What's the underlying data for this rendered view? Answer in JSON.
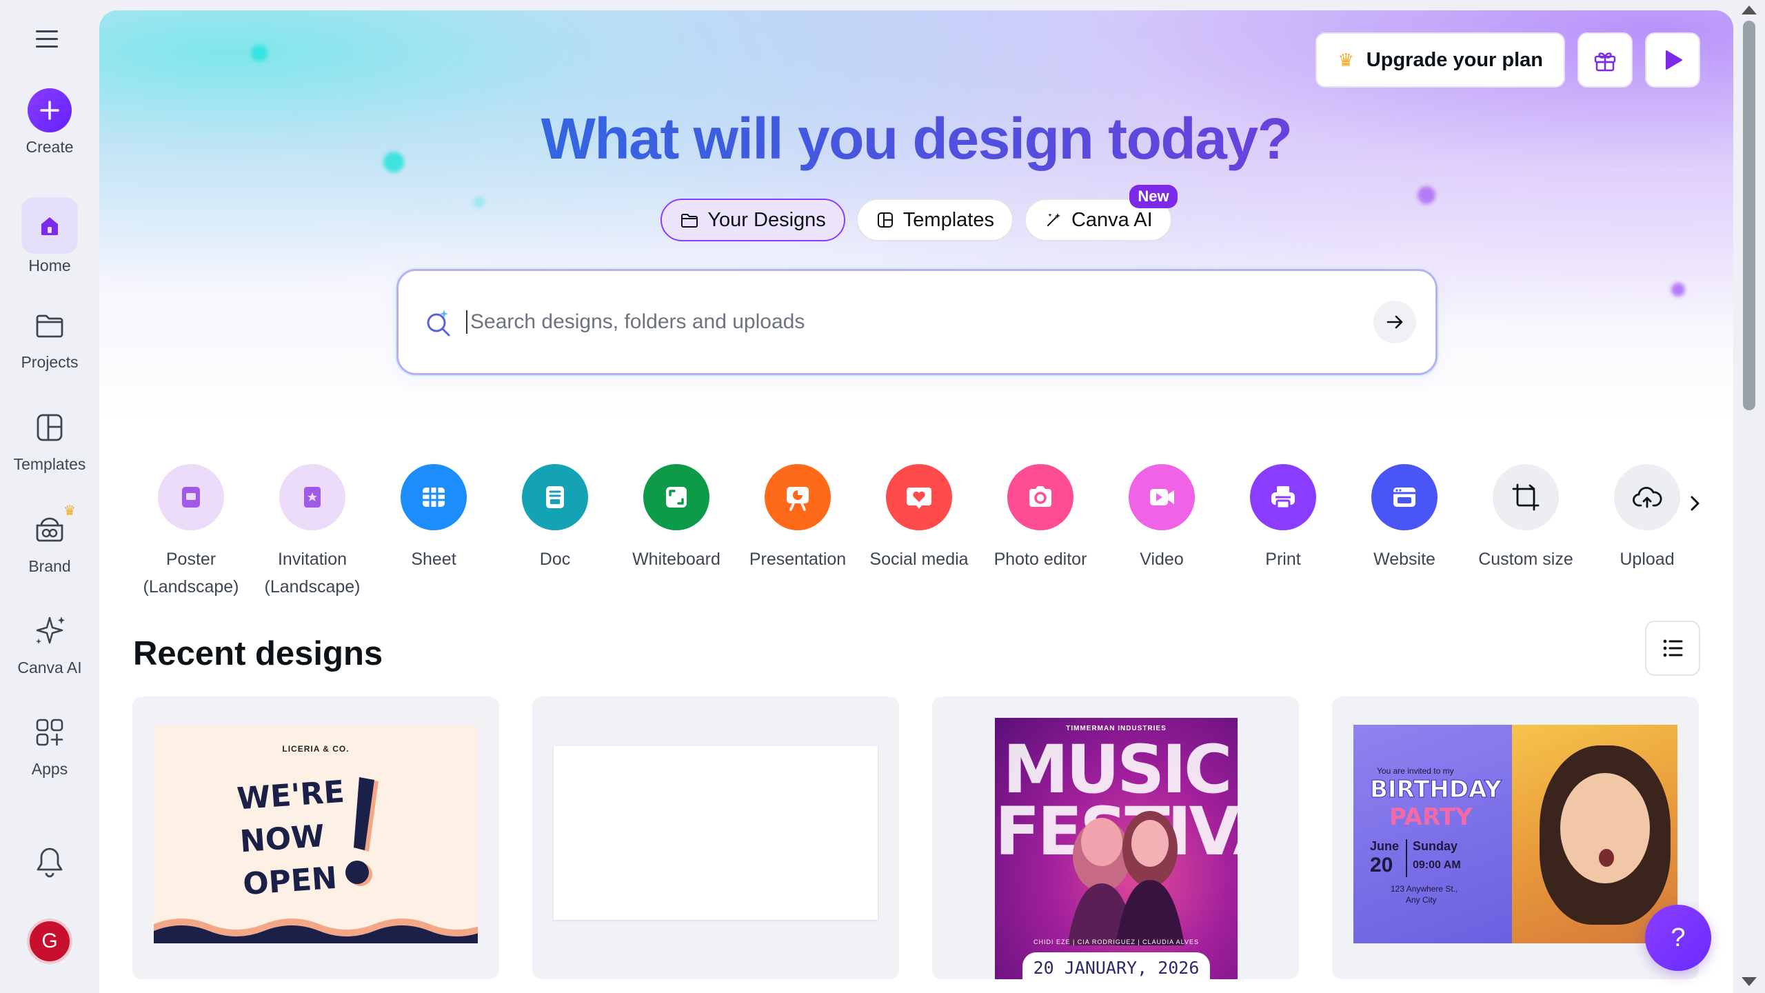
{
  "sidebar": {
    "items": [
      {
        "label": "Create",
        "icon": "plus-icon"
      },
      {
        "label": "Home",
        "icon": "home-icon"
      },
      {
        "label": "Projects",
        "icon": "folder-icon"
      },
      {
        "label": "Templates",
        "icon": "templates-icon"
      },
      {
        "label": "Brand",
        "icon": "brand-icon"
      },
      {
        "label": "Canva AI",
        "icon": "sparkles-icon"
      },
      {
        "label": "Apps",
        "icon": "apps-grid-icon"
      }
    ],
    "avatar_initial": "G"
  },
  "topbar": {
    "upgrade_label": "Upgrade your plan"
  },
  "hero": {
    "title": "What will you design today?",
    "tabs": [
      {
        "label": "Your Designs",
        "active": true
      },
      {
        "label": "Templates",
        "active": false
      },
      {
        "label": "Canva AI",
        "active": false,
        "badge": "New"
      }
    ]
  },
  "search": {
    "placeholder": "Search designs, folders and uploads",
    "value": ""
  },
  "design_types": [
    {
      "label": "Poster (Landscape)",
      "color": "#ecdcfa",
      "icon": "poster-icon"
    },
    {
      "label": "Invitation (Landscape)",
      "color": "#ecdcfa",
      "icon": "invitation-icon"
    },
    {
      "label": "Sheet",
      "color": "#1c8dfb",
      "icon": "sheet-icon"
    },
    {
      "label": "Doc",
      "color": "#13a3b5",
      "icon": "doc-icon"
    },
    {
      "label": "Whiteboard",
      "color": "#0d9b4a",
      "icon": "whiteboard-icon"
    },
    {
      "label": "Presentation",
      "color": "#ff6a1a",
      "icon": "presentation-icon"
    },
    {
      "label": "Social media",
      "color": "#ff4b4b",
      "icon": "heart-icon"
    },
    {
      "label": "Photo editor",
      "color": "#ff4d94",
      "icon": "camera-icon"
    },
    {
      "label": "Video",
      "color": "#f062e6",
      "icon": "video-icon"
    },
    {
      "label": "Print",
      "color": "#8b3dff",
      "icon": "print-icon"
    },
    {
      "label": "Website",
      "color": "#4a55f5",
      "icon": "website-icon"
    },
    {
      "label": "Custom size",
      "color": "#eceef2",
      "icon": "custom-size-icon"
    },
    {
      "label": "Upload",
      "color": "#eceef2",
      "icon": "upload-cloud-icon"
    }
  ],
  "recent": {
    "title": "Recent designs",
    "cards": [
      {
        "brand": "LICERIA & CO.",
        "line1": "WE'RE",
        "line2": "NOW",
        "line3": "OPEN"
      },
      {},
      {
        "top": "TIMMERMAN INDUSTRIES",
        "title": "MUSIC FESTIVAL",
        "names": "CHIDI EZE | CIA RODRIGUEZ | CLAUDIA ALVES",
        "date": "20 JANUARY, 2026"
      },
      {
        "invite": "You are invited to my",
        "line1": "BIRTHDAY",
        "line2": "PARTY",
        "month": "June",
        "day": "20",
        "weekday": "Sunday",
        "time": "09:00 AM",
        "addr1": "123 Anywhere St.,",
        "addr2": "Any City"
      }
    ]
  },
  "help_label": "?",
  "colors": {
    "accent": "#8b3dff",
    "brand_title_start": "#1b7be8",
    "brand_title_end": "#7c3fd9"
  }
}
